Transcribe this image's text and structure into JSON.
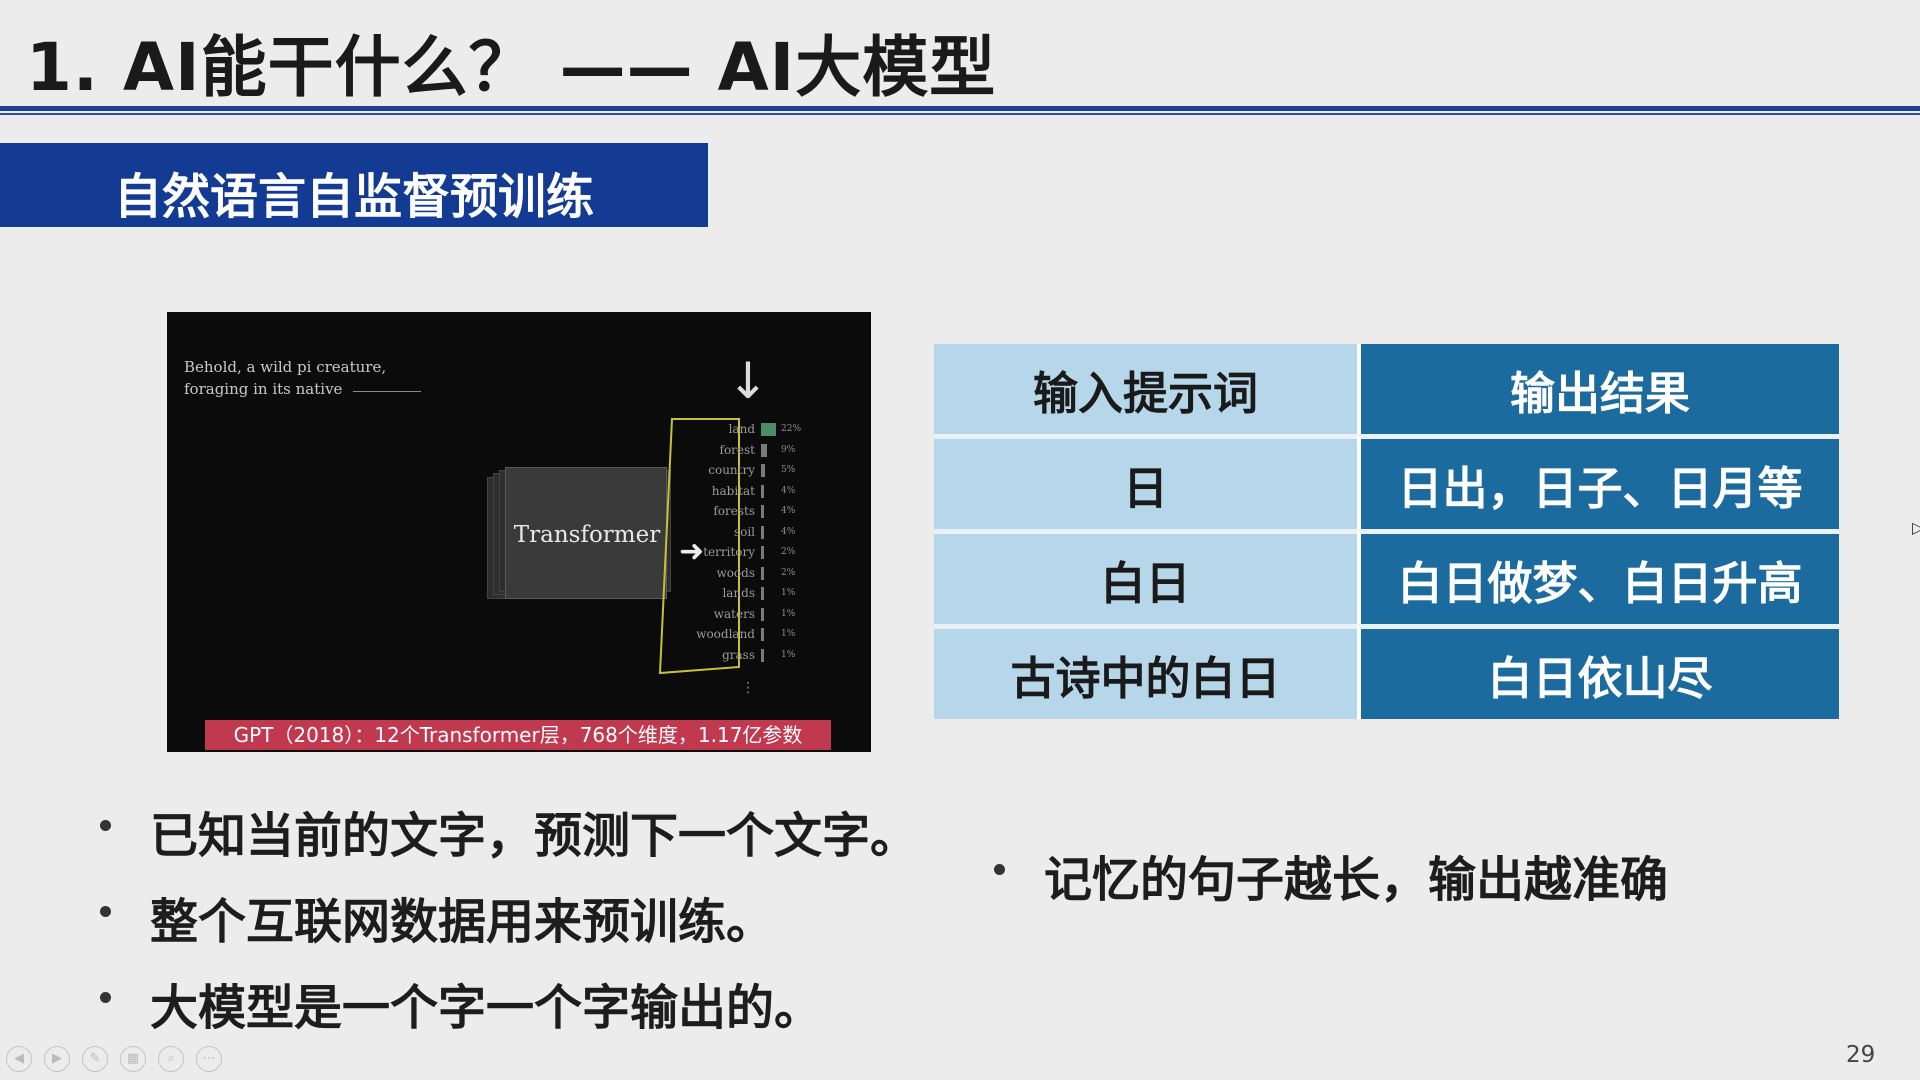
{
  "slide": {
    "title": "1. AI能干什么？ —— AI大模型",
    "section": "自然语言自监督预训练",
    "page_number": "29"
  },
  "video": {
    "prompt": "Behold, a wild pi creature,\nforaging in its native",
    "transformer_label": "Transformer",
    "caption": "GPT（2018）：12个Transformer层，768个维度，1.17亿参数",
    "predictions": [
      {
        "word": "land",
        "pct": "22%",
        "prob": 0.22
      },
      {
        "word": "forest",
        "pct": "9%",
        "prob": 0.09
      },
      {
        "word": "country",
        "pct": "5%",
        "prob": 0.05
      },
      {
        "word": "habitat",
        "pct": "4%",
        "prob": 0.04
      },
      {
        "word": "forests",
        "pct": "4%",
        "prob": 0.04
      },
      {
        "word": "soil",
        "pct": "4%",
        "prob": 0.04
      },
      {
        "word": "territory",
        "pct": "2%",
        "prob": 0.02
      },
      {
        "word": "woods",
        "pct": "2%",
        "prob": 0.02
      },
      {
        "word": "lands",
        "pct": "1%",
        "prob": 0.01
      },
      {
        "word": "waters",
        "pct": "1%",
        "prob": 0.01
      },
      {
        "word": "woodland",
        "pct": "1%",
        "prob": 0.01
      },
      {
        "word": "grass",
        "pct": "1%",
        "prob": 0.01
      }
    ]
  },
  "table": {
    "header": {
      "input": "输入提示词",
      "output": "输出结果"
    },
    "rows": [
      {
        "input": "日",
        "output": "日出，日子、日月等"
      },
      {
        "input": "白日",
        "output": "白日做梦、白日升高"
      },
      {
        "input": "古诗中的白日",
        "output": "白日依山尽"
      }
    ]
  },
  "bullets": [
    "已知当前的文字，预测下一个文字。",
    "整个互联网数据用来预训练。",
    "大模型是一个字一个字输出的。"
  ],
  "side_bullet": "记忆的句子越长，输出越准确",
  "toolbar": {
    "icons": [
      "prev-icon",
      "next-icon",
      "pen-icon",
      "slides-icon",
      "zoom-icon",
      "more-icon"
    ]
  },
  "colors": {
    "banner": "#133b94",
    "table_input": "#b6d7ea",
    "table_output": "#1c6b9e",
    "caption": "#c0394f"
  }
}
